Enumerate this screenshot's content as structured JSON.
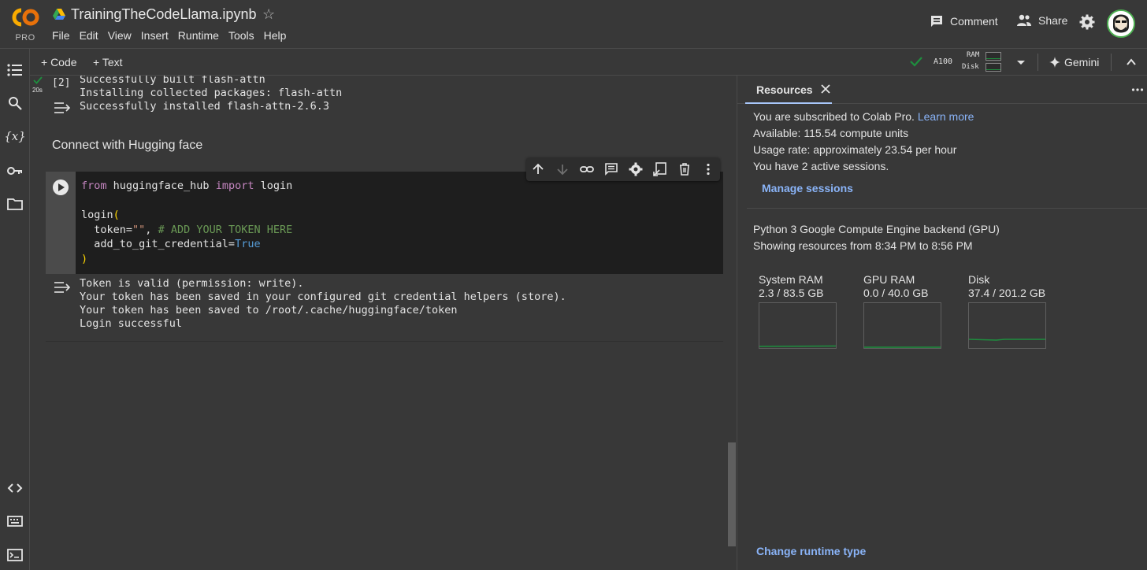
{
  "header": {
    "logo_pro": "PRO",
    "title": "TrainingTheCodeLlama.ipynb",
    "menu": [
      "File",
      "Edit",
      "View",
      "Insert",
      "Runtime",
      "Tools",
      "Help"
    ],
    "comment_label": "Comment",
    "share_label": "Share"
  },
  "toolbar": {
    "add_code": "+ Code",
    "add_text": "+ Text",
    "gpu": "A100",
    "ram_label": "RAM",
    "disk_label": "Disk",
    "gemini_label": "Gemini"
  },
  "cell2": {
    "number": "[2]",
    "time": "20s",
    "output": "Successfully built flash-attn\nInstalling collected packages: flash-attn\nSuccessfully installed flash-attn-2.6.3"
  },
  "markdown_cell": {
    "text": "Connect with Hugging face"
  },
  "code_cell": {
    "line1_kw1": "from",
    "line1_mod": " huggingface_hub ",
    "line1_kw2": "import",
    "line1_name": " login",
    "line3_fn": "login",
    "line3_paren": "(",
    "line4_arg": "  token=",
    "line4_str": "\"\"",
    "line4_comma": ", ",
    "line4_comment": "# ADD YOUR TOKEN HERE",
    "line5_arg": "  add_to_git_credential=",
    "line5_bool": "True",
    "line6_paren": ")",
    "output": "Token is valid (permission: write).\nYour token has been saved in your configured git credential helpers (store).\nYour token has been saved to /root/.cache/huggingface/token\nLogin successful"
  },
  "resources": {
    "tab_label": "Resources",
    "subscribed": "You are subscribed to Colab Pro.",
    "learn_more": "Learn more",
    "available": "Available: 115.54 compute units",
    "usage_rate": "Usage rate: approximately 23.54 per hour",
    "sessions": "You have 2 active sessions.",
    "manage_sessions": "Manage sessions",
    "backend": "Python 3 Google Compute Engine backend (GPU)",
    "showing_from": "Showing resources from 8:34 PM to 8:56 PM",
    "gauges": [
      {
        "title": "System RAM",
        "value": "2.3 / 83.5 GB",
        "fraction": 0.028
      },
      {
        "title": "GPU RAM",
        "value": "0.0 / 40.0 GB",
        "fraction": 0.0
      },
      {
        "title": "Disk",
        "value": "37.4 / 201.2 GB",
        "fraction": 0.186
      }
    ],
    "change_runtime": "Change runtime type"
  },
  "colors": {
    "accent_link": "#8ab4f8",
    "success_green": "#1e8e3e",
    "logo_orange": "#f9ab00"
  }
}
